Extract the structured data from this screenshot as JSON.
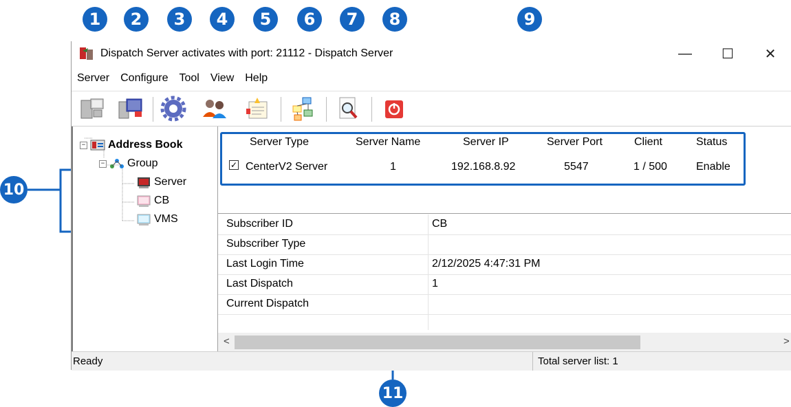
{
  "callouts": [
    "1",
    "2",
    "3",
    "4",
    "5",
    "6",
    "7",
    "8",
    "9",
    "10",
    "11"
  ],
  "window": {
    "title": "Dispatch Server activates with port: 21112 - Dispatch Server",
    "minimize": "—",
    "maximize": "☐",
    "close": "✕"
  },
  "menu": [
    "Server",
    "Configure",
    "Tool",
    "View",
    "Help"
  ],
  "toolbar_icons": [
    "server-computers-icon",
    "server-monitor-icon",
    "settings-gear-icon",
    "users-icon",
    "alert-log-icon",
    "network-topology-icon",
    "search-document-icon",
    "power-icon"
  ],
  "tree": {
    "root": "Address Book",
    "group": "Group",
    "children": [
      "Server",
      "CB",
      "VMS"
    ]
  },
  "server_table": {
    "headers": [
      "Server Type",
      "Server Name",
      "Server IP",
      "Server Port",
      "Client",
      "Status"
    ],
    "rows": [
      {
        "checked": true,
        "type": "CenterV2 Server",
        "name": "1",
        "ip": "192.168.8.92",
        "port": "5547",
        "client": "1 / 500",
        "status": "Enable"
      }
    ]
  },
  "properties": [
    {
      "key": "Subscriber ID",
      "value": "CB"
    },
    {
      "key": "Subscriber Type",
      "value": ""
    },
    {
      "key": "Last Login Time",
      "value": "2/12/2025 4:47:31 PM"
    },
    {
      "key": "Last Dispatch",
      "value": "1"
    },
    {
      "key": "Current Dispatch",
      "value": ""
    }
  ],
  "status": {
    "left": "Ready",
    "right": "Total server list: 1"
  },
  "colors": {
    "callout": "#1565c0"
  }
}
